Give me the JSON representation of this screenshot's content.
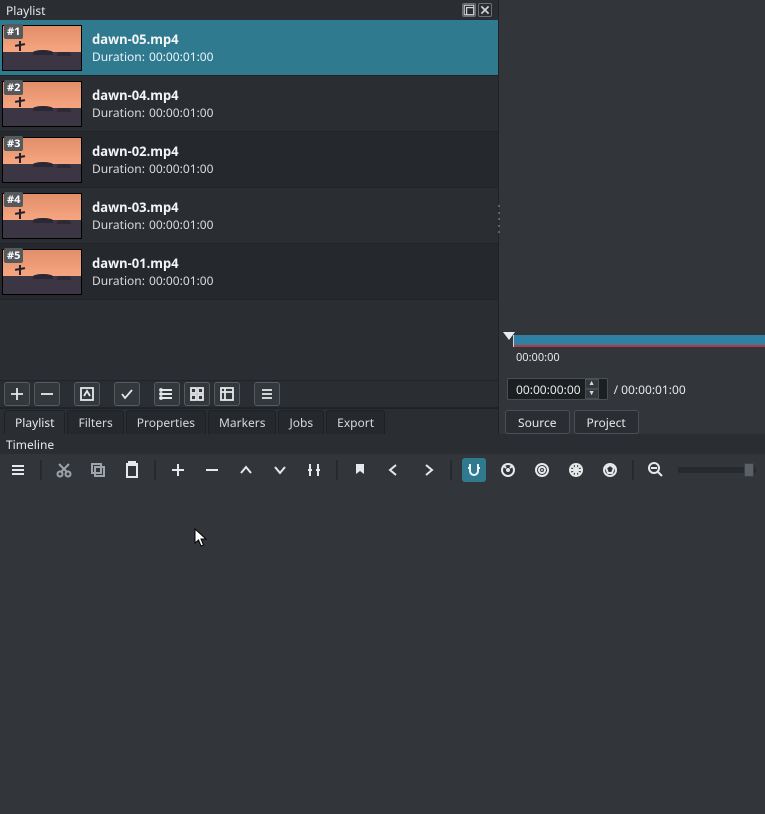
{
  "playlist": {
    "title": "Playlist",
    "items": [
      {
        "index": "#1",
        "name": "dawn-05.mp4",
        "duration_label": "Duration:",
        "duration": "00:00:01:00",
        "selected": true
      },
      {
        "index": "#2",
        "name": "dawn-04.mp4",
        "duration_label": "Duration:",
        "duration": "00:00:01:00",
        "selected": false
      },
      {
        "index": "#3",
        "name": "dawn-02.mp4",
        "duration_label": "Duration:",
        "duration": "00:00:01:00",
        "selected": false
      },
      {
        "index": "#4",
        "name": "dawn-03.mp4",
        "duration_label": "Duration:",
        "duration": "00:00:01:00",
        "selected": false
      },
      {
        "index": "#5",
        "name": "dawn-01.mp4",
        "duration_label": "Duration:",
        "duration": "00:00:01:00",
        "selected": false
      }
    ],
    "toolbar": {
      "add": "add",
      "remove": "remove",
      "update": "update",
      "check": "check",
      "view_list": "list",
      "view_tiles": "tiles",
      "view_details": "details",
      "menu": "menu"
    }
  },
  "tabs": {
    "items": [
      {
        "label": "Playlist"
      },
      {
        "label": "Filters"
      },
      {
        "label": "Properties"
      },
      {
        "label": "Markers"
      },
      {
        "label": "Jobs"
      },
      {
        "label": "Export"
      }
    ]
  },
  "preview": {
    "scrubber_time": "00:00:00",
    "current_tc": "00:00:00:00",
    "total_tc": "/ 00:00:01:00",
    "tabs": [
      {
        "label": "Source"
      },
      {
        "label": "Project"
      }
    ]
  },
  "timeline": {
    "title": "Timeline"
  }
}
